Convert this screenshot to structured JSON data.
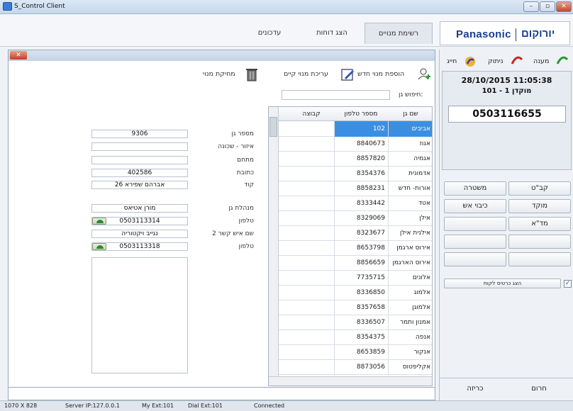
{
  "window": {
    "title": "S_Control Client"
  },
  "tabs": {
    "updates": "עדכונים",
    "reports": "הצג דוחות",
    "subscribers": "רשימת מנויים"
  },
  "brand": {
    "panasonic": "Panasonic",
    "hebrew": "יורוקום"
  },
  "toolbar": {
    "add": "הוספת מנוי חדש",
    "edit": "עריכת מנוי קיים",
    "delete": "מחיקת מנוי",
    "search_label": "חיפוש גן:",
    "search_value": ""
  },
  "form": {
    "garden_no_label": "מספר גן",
    "garden_no": "9306",
    "area_label": "איזור - שכונה",
    "area": "",
    "district_label": "מתחם",
    "district": "",
    "address_label": "כתובת",
    "address": "402586",
    "code_label": "קוד",
    "code": "אברהם שפירא 26",
    "manager_label": "מנהלת גן",
    "manager": "מורן אטיאס",
    "phone_label": "טלפון",
    "phone": "0503113314",
    "contact2_label": "שם איש קשר 2",
    "contact2": "נגייב ויקטוריה",
    "phone2_label": "טלפון",
    "phone2": "0503113318"
  },
  "grid": {
    "headers": {
      "name": "שם גן",
      "phone": "מספר טלפון",
      "group": "קבוצה"
    },
    "rows": [
      {
        "name": "אביבים",
        "phone": "102"
      },
      {
        "name": "אגוז",
        "phone": "8840673"
      },
      {
        "name": "אגמיה",
        "phone": "8857820"
      },
      {
        "name": "אדמונית",
        "phone": "8354376"
      },
      {
        "name": "אורות- חדש",
        "phone": "8858231"
      },
      {
        "name": "אטד",
        "phone": "8333442"
      },
      {
        "name": "אילן",
        "phone": "8329069"
      },
      {
        "name": "אילנית אילן",
        "phone": "8323677"
      },
      {
        "name": "אירוס ארגמן",
        "phone": "8653798"
      },
      {
        "name": "אירוס הארגמן",
        "phone": "8856659"
      },
      {
        "name": "אלונים",
        "phone": "7735715"
      },
      {
        "name": "אלמוג",
        "phone": "8336850"
      },
      {
        "name": "אלמוגן",
        "phone": "8357658"
      },
      {
        "name": "אמנון ותמר",
        "phone": "8336507"
      },
      {
        "name": "אנפה",
        "phone": "8354375"
      },
      {
        "name": "אנקור",
        "phone": "8653859"
      },
      {
        "name": "אקליפטוס",
        "phone": "8873056"
      }
    ]
  },
  "call": {
    "answer": "מענה",
    "hangup": "ניתוק",
    "dial": "חייג",
    "datetime": "28/10/2015 11:05:38",
    "line": "101 - מוקדן 1",
    "number": "0503116655"
  },
  "quick": {
    "kabat": "קב\"ט",
    "police": "משטרה",
    "center": "מוקד",
    "fire": "כיבוי אש",
    "mda": "מד\"א",
    "show_card": "הצג כרטיס לקוח"
  },
  "bottom": {
    "emergency": "חרום",
    "alarm": "כריזה"
  },
  "status": {
    "resolution": "1070 X 828",
    "server": "Server IP:127.0.0.1",
    "myext": "My Ext:101",
    "dialext": "Dial Ext:101",
    "conn": "Connected"
  }
}
